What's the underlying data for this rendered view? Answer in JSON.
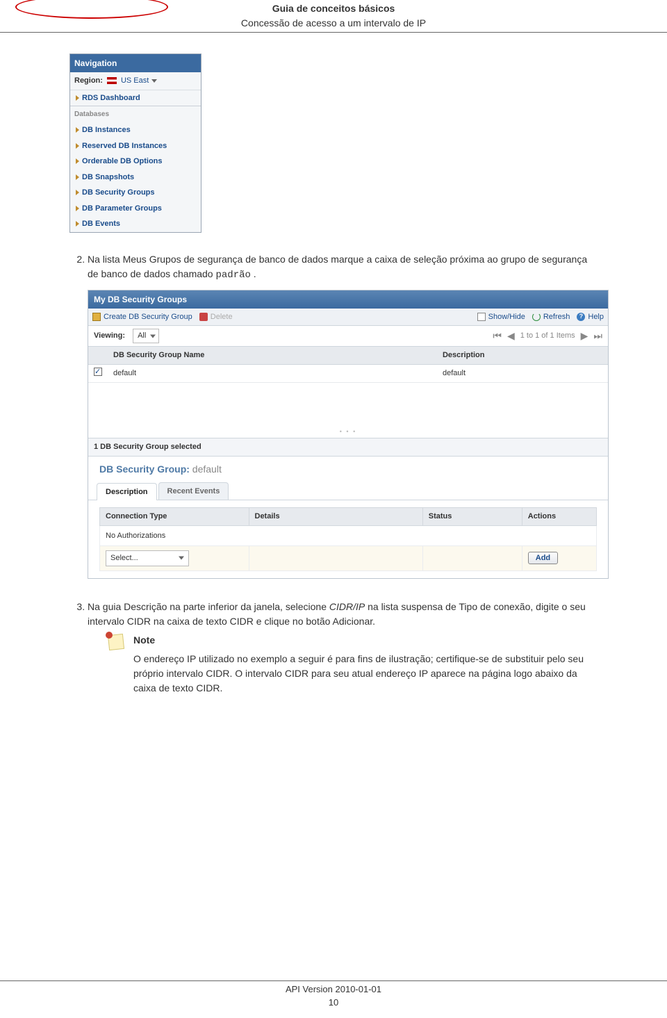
{
  "header": {
    "title": "Guia de conceitos básicos",
    "subtitle": "Concessão de acesso a um intervalo de IP"
  },
  "nav": {
    "title": "Navigation",
    "region_label": "Region:",
    "region_value": "US East",
    "items": [
      "RDS Dashboard"
    ],
    "databases_label": "Databases",
    "db_items": [
      "DB Instances",
      "Reserved DB Instances",
      "Orderable DB Options",
      "DB Snapshots",
      "DB Security Groups",
      "DB Parameter Groups",
      "DB Events"
    ]
  },
  "steps": {
    "s2_a": "Na lista Meus Grupos de segurança de banco de dados marque a caixa de seleção próxima ao grupo de segurança de banco de dados chamado ",
    "s2_b": " .",
    "s2_code": "padrão",
    "s3_a": "Na guia Descrição na parte inferior da janela, selecione ",
    "s3_cidrip": "CIDR/IP",
    "s3_b": " na lista suspensa de Tipo de conexão, digite o seu intervalo CIDR na caixa de texto CIDR e clique no botão Adicionar."
  },
  "sg": {
    "title": "My DB Security Groups",
    "create_btn": "Create DB Security Group",
    "delete_btn": "Delete",
    "showhide": "Show/Hide",
    "refresh": "Refresh",
    "help": "Help",
    "viewing_label": "Viewing:",
    "viewing_value": "All",
    "pager_text": "1 to 1 of 1 Items",
    "col_name": "DB Security Group Name",
    "col_desc": "Description",
    "row_name": "default",
    "row_desc": "default",
    "selected_text": "1 DB Security Group selected",
    "group_label": "DB Security Group:",
    "group_name": "default",
    "tab_desc": "Description",
    "tab_events": "Recent Events",
    "dcol_conn": "Connection Type",
    "dcol_details": "Details",
    "dcol_status": "Status",
    "dcol_actions": "Actions",
    "no_auth": "No Authorizations",
    "select_dd": "Select...",
    "add_btn": "Add"
  },
  "note": {
    "title": "Note",
    "body": "O endereço IP utilizado no exemplo a seguir é para fins de ilustração; certifique-se de substituir pelo seu próprio intervalo CIDR. O intervalo CIDR para seu atual endereço IP aparece na página logo abaixo da caixa de texto CIDR."
  },
  "footer": {
    "api": "API Version 2010-01-01",
    "page": "10"
  }
}
